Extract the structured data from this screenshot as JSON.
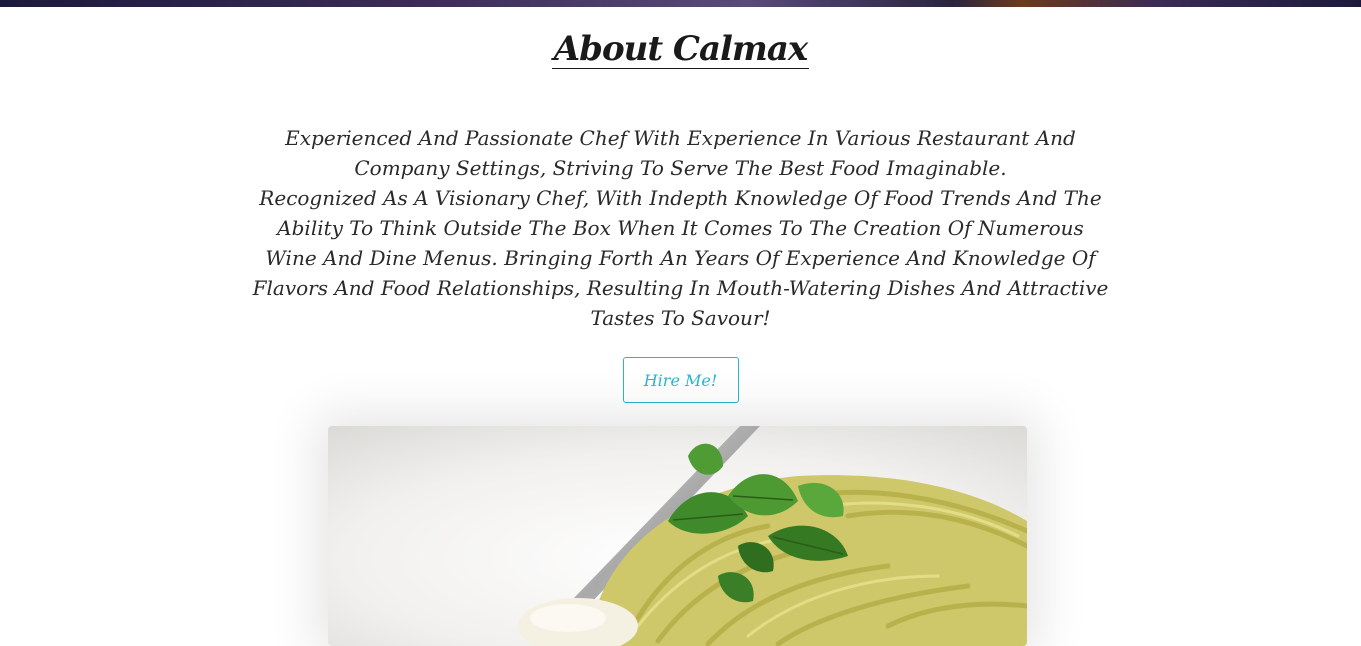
{
  "section": {
    "title": "About Calmax",
    "paragraphs": [
      "Experienced And Passionate Chef With Experience In Various Restaurant And Company Settings, Striving To Serve The Best Food Imaginable.",
      "Recognized As A Visionary Chef, With Indepth Knowledge Of Food Trends And The Ability To Think Outside The Box When It Comes To The Creation Of Numerous Wine And Dine Menus. Bringing Forth An Years Of Experience And Knowledge Of Flavors And Food Relationships, Resulting In Mouth-Watering Dishes And Attractive Tastes To Savour!"
    ],
    "cta_label": "Hire Me!"
  },
  "image": {
    "subject": "pesto-pasta-dish-photo"
  },
  "colors": {
    "accent": "#27b8cf",
    "text": "#2a2a2a",
    "background": "#ffffff"
  }
}
